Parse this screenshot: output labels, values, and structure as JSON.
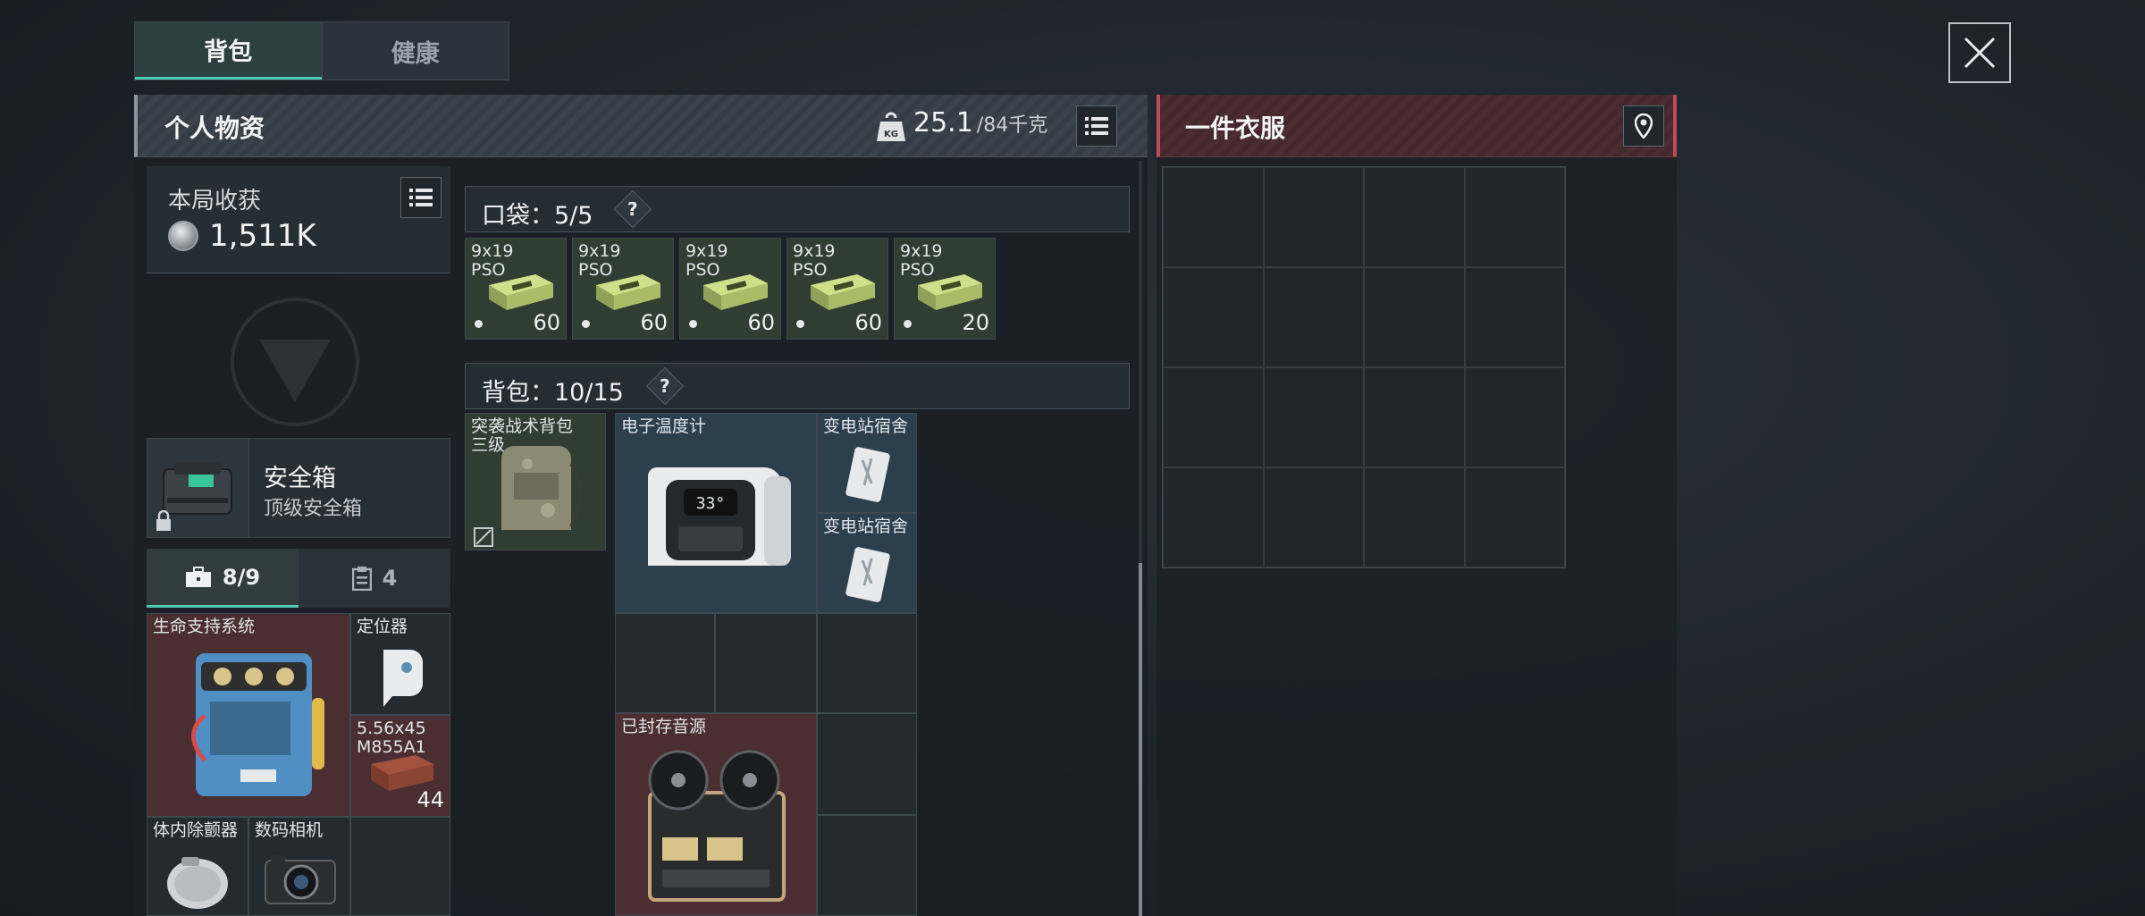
{
  "top_tabs": [
    {
      "label": "背包",
      "active": true
    },
    {
      "label": "健康",
      "active": false
    }
  ],
  "inventory": {
    "title": "个人物资",
    "weight_current": "25.1",
    "weight_max": "/84千克",
    "weight_icon": "kg-weight-icon",
    "list_icon": "list-icon"
  },
  "earnings": {
    "label": "本局收获",
    "value": "1,511K",
    "currency_icon": "coin-icon"
  },
  "safe_box": {
    "name": "安全箱",
    "subtitle": "顶级安全箱"
  },
  "secure_tabs": [
    {
      "label": "8/9",
      "icon": "briefcase-icon",
      "active": true
    },
    {
      "label": "4",
      "icon": "clipboard-icon",
      "active": false
    }
  ],
  "secure_items": [
    {
      "label": "生命支持系统",
      "count": ""
    },
    {
      "label": "定位器",
      "count": ""
    },
    {
      "label": "5.56x45\nM855A1",
      "count": "44"
    },
    {
      "label": "体内除颤器",
      "count": ""
    },
    {
      "label": "数码相机",
      "count": ""
    }
  ],
  "pockets": {
    "label": "口袋：5/5",
    "items": [
      {
        "label": "9x19\nPSO",
        "count": "60"
      },
      {
        "label": "9x19\nPSO",
        "count": "60"
      },
      {
        "label": "9x19\nPSO",
        "count": "60"
      },
      {
        "label": "9x19\nPSO",
        "count": "60"
      },
      {
        "label": "9x19\nPSO",
        "count": "20"
      }
    ]
  },
  "backpack": {
    "label": "背包：10/15",
    "items": [
      {
        "label": "突袭战术背包\n三级"
      },
      {
        "label": "电子温度计"
      },
      {
        "label": "变电站宿舍"
      },
      {
        "label": "变电站宿舍"
      },
      {
        "label": "已封存音源"
      }
    ]
  },
  "clothing": {
    "title": "一件衣服",
    "pin_icon": "location-pin-icon"
  },
  "colors": {
    "accent": "#4fc7b3",
    "danger": "#c04a55"
  }
}
